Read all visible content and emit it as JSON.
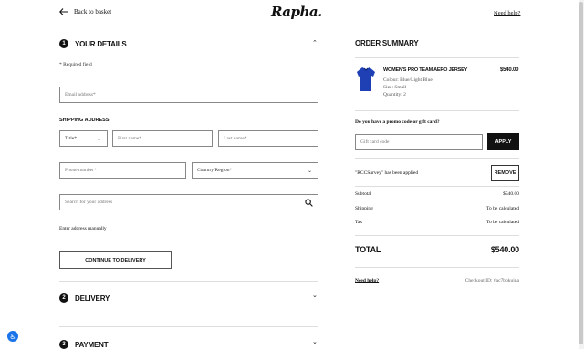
{
  "header": {
    "back_label": "Back to basket",
    "logo": "Rapha.",
    "help_label": "Need help?"
  },
  "steps": [
    {
      "num": "1",
      "title": "YOUR DETAILS"
    },
    {
      "num": "2",
      "title": "DELIVERY"
    },
    {
      "num": "3",
      "title": "PAYMENT"
    }
  ],
  "details": {
    "required_note": "* Required field",
    "email_placeholder": "Email address*",
    "shipping_label": "SHIPPING ADDRESS",
    "title_value": "Title*",
    "first_name_placeholder": "First name*",
    "last_name_placeholder": "Last name*",
    "phone_placeholder": "Phone number*",
    "country_value": "Country/Region*",
    "address_search_placeholder": "Search for your address",
    "manual_link": "Enter address manually",
    "continue_label": "CONTINUE TO DELIVERY"
  },
  "summary": {
    "title": "ORDER SUMMARY",
    "product": {
      "name": "WOMEN'S PRO TEAM AERO JERSEY",
      "price": "$540.00",
      "colour": "Colour: Blue/Light Blue",
      "size": "Size: Small",
      "quantity": "Quantity: 2"
    },
    "promo_question": "Do you have a promo code or gift card?",
    "gift_placeholder": "Gift card code",
    "apply_label": "APPLY",
    "applied_text": "\"RCCSurvey\" has been applied",
    "remove_label": "REMOVE",
    "rows": [
      {
        "label": "Subtotal",
        "value": "$540.00"
      },
      {
        "label": "Shipping",
        "value": "To be calculated"
      },
      {
        "label": "Tax",
        "value": "To be calculated"
      }
    ],
    "total_label": "TOTAL",
    "total_value": "$540.00",
    "help_label": "Need help?",
    "checkout_id": "Checkout ID: #ac7bokujna"
  },
  "colors": {
    "accent": "#111111",
    "jersey": "#1f3fb5",
    "accessibility": "#1a73e8"
  }
}
